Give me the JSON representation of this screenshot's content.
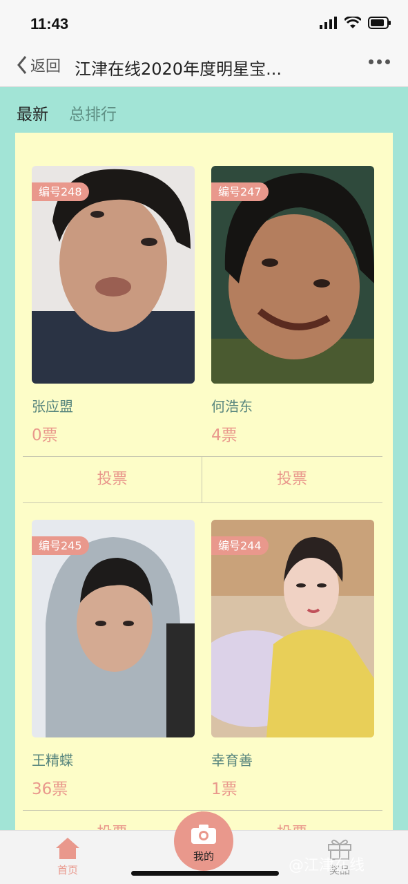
{
  "status": {
    "time": "11:43"
  },
  "nav": {
    "back_label": "返回",
    "title": "江津在线2020年度明星宝..."
  },
  "tabs": [
    {
      "label": "最新"
    },
    {
      "label": "总排行"
    }
  ],
  "contestants": [
    {
      "badge": "编号248",
      "name": "张应盟",
      "votes": "0票"
    },
    {
      "badge": "编号247",
      "name": "何浩东",
      "votes": "4票"
    },
    {
      "badge": "编号245",
      "name": "王精蝶",
      "votes": "36票"
    },
    {
      "badge": "编号244",
      "name": "幸育善",
      "votes": "1票"
    }
  ],
  "vote_label": "投票",
  "tabbar": {
    "home": "首页",
    "mine": "我的",
    "prize": "奖品"
  },
  "watermark": "@江津在线",
  "colors": {
    "teal_bg": "#a2e4d6",
    "panel": "#fdfdc8",
    "accent": "#e9988c",
    "name_text": "#57857d"
  }
}
